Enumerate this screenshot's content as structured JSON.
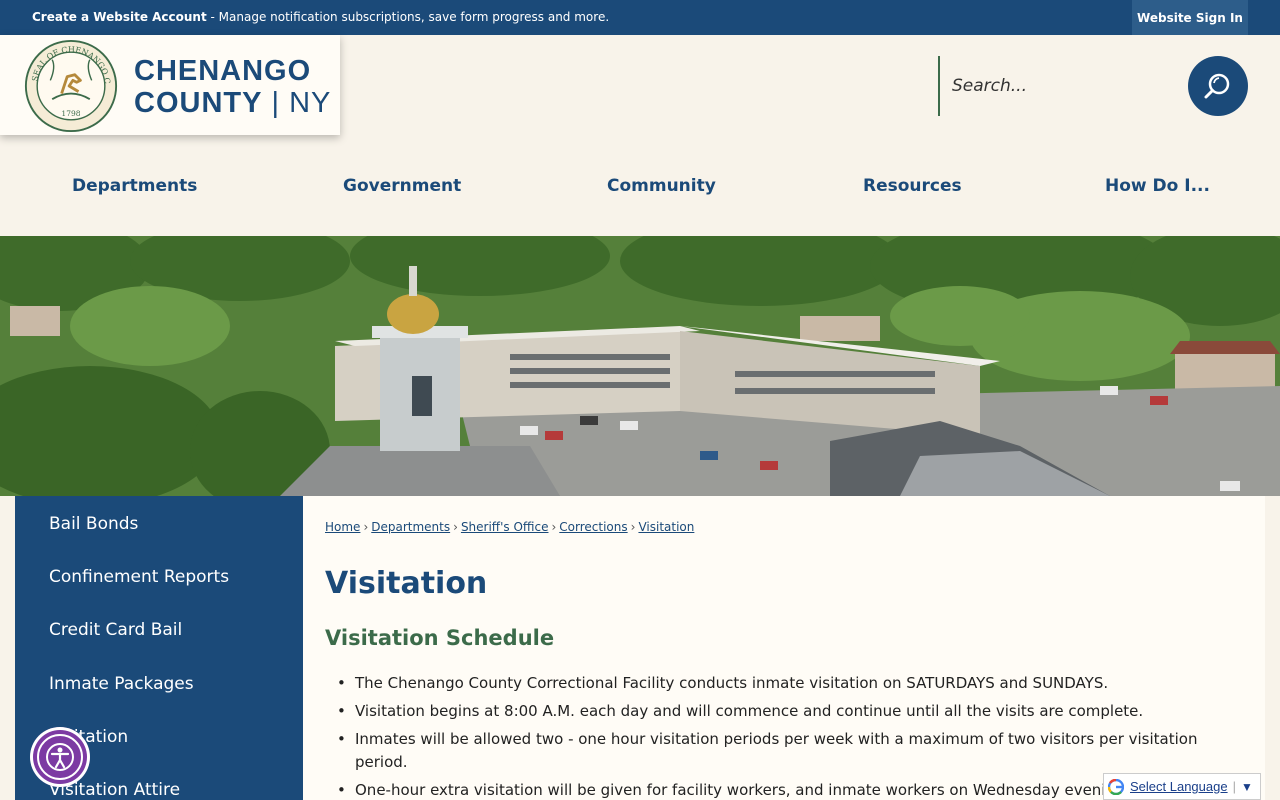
{
  "topbar": {
    "account_title": "Create a Website Account",
    "account_desc": " - Manage notification subscriptions, save form progress and more.",
    "sign_in": "Website Sign In"
  },
  "header": {
    "county_name_line1": "CHENANGO",
    "county_name_line2": "COUNTY",
    "county_state_sep": " | ",
    "county_state": "NY",
    "seal": {
      "outer_text": "SEAL OF CHENANGO COUNTY N.Y.",
      "year": "1798"
    }
  },
  "search": {
    "placeholder": "Search..."
  },
  "nav": {
    "items": [
      "Departments",
      "Government",
      "Community",
      "Resources",
      "How Do I..."
    ]
  },
  "sidebar": {
    "items": [
      "Bail Bonds",
      "Confinement Reports",
      "Credit Card Bail",
      "Inmate Packages",
      "Visitation",
      "Visitation Attire"
    ]
  },
  "breadcrumb": [
    "Home",
    "Departments",
    "Sheriff's Office",
    "Corrections",
    "Visitation"
  ],
  "main": {
    "title": "Visitation",
    "subtitle": "Visitation Schedule",
    "bullets": [
      "The Chenango County Correctional Facility conducts inmate visitation on SATURDAYS and SUNDAYS.",
      "Visitation begins at 8:00 A.M. each day and will commence and continue until all the visits are complete.",
      "Inmates will be allowed two - one hour visitation periods per week with a maximum of two visitors per visitation period.",
      "One-hour extra visitation will be given for facility workers, and inmate workers on Wednesday evenings."
    ]
  },
  "translate": {
    "label": "Select Language",
    "arrow": "▼"
  },
  "colors": {
    "primary": "#1b4a79",
    "accent_green": "#3c6b4a",
    "background": "#f8f3ea",
    "accessibility": "#7c3aa3"
  },
  "icons": {
    "search": "search-icon",
    "accessibility": "accessibility-icon",
    "google": "google-icon"
  }
}
